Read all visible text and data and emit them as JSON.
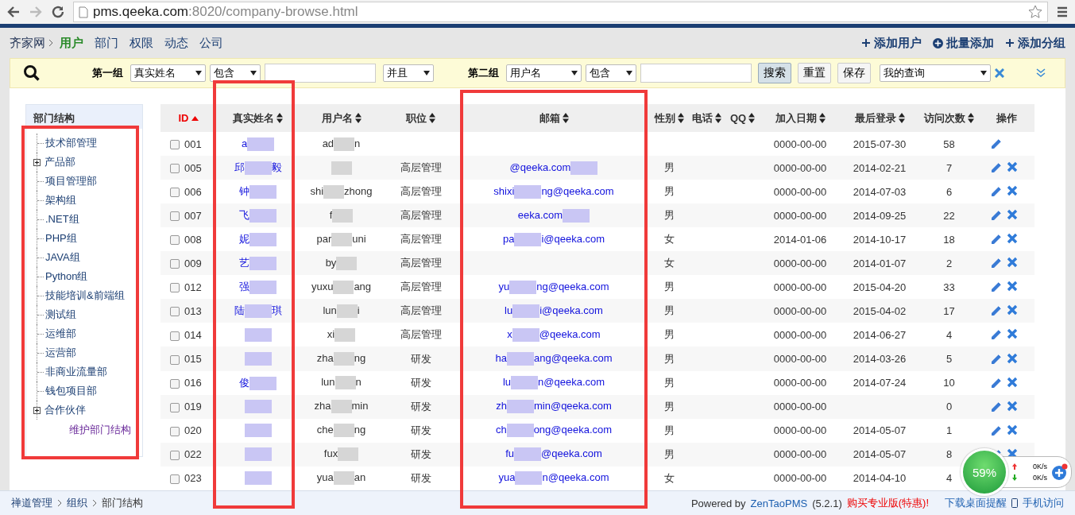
{
  "browser": {
    "url_host": "pms.qeeka.com",
    "url_rest": ":8020/company-browse.html"
  },
  "nav": {
    "root": "齐家网",
    "tabs": [
      {
        "label": "用户",
        "selected": true
      },
      {
        "label": "部门",
        "selected": false
      },
      {
        "label": "权限",
        "selected": false
      },
      {
        "label": "动态",
        "selected": false
      },
      {
        "label": "公司",
        "selected": false
      }
    ],
    "actions": [
      {
        "kind": "plus",
        "label": "添加用户"
      },
      {
        "kind": "plus-circle",
        "label": "批量添加"
      },
      {
        "kind": "plus",
        "label": "添加分组"
      }
    ]
  },
  "filter": {
    "group1": {
      "label": "第一组",
      "field": "真实姓名",
      "operator": "包含"
    },
    "join": "并且",
    "group2": {
      "label": "第二组",
      "field": "用户名",
      "operator": "包含"
    },
    "buttons": [
      {
        "label": "搜索",
        "selected": true
      },
      {
        "label": "重置",
        "selected": false
      },
      {
        "label": "保存",
        "selected": false
      }
    ],
    "saved_query": "我的查询"
  },
  "sidebar": {
    "title": "部门结构",
    "items": [
      {
        "label": "技术部管理",
        "expandable": false
      },
      {
        "label": "产品部",
        "expandable": true
      },
      {
        "label": "项目管理部",
        "expandable": false
      },
      {
        "label": "架构组",
        "expandable": false
      },
      {
        "label": ".NET组",
        "expandable": false
      },
      {
        "label": "PHP组",
        "expandable": false
      },
      {
        "label": "JAVA组",
        "expandable": false
      },
      {
        "label": "Python组",
        "expandable": false
      },
      {
        "label": "技能培训&前端组",
        "expandable": false
      },
      {
        "label": "测试组",
        "expandable": false
      },
      {
        "label": "运维部",
        "expandable": false
      },
      {
        "label": "运营部",
        "expandable": false
      },
      {
        "label": "非商业流量部",
        "expandable": false
      },
      {
        "label": "钱包项目部",
        "expandable": false
      },
      {
        "label": "合作伙伴",
        "expandable": true
      }
    ],
    "link": "维护部门结构",
    "highlighted": true
  },
  "table": {
    "columns": [
      {
        "label": "ID",
        "sortable": true,
        "sorted": true
      },
      {
        "label": "真实姓名",
        "sortable": true,
        "sorted": false,
        "highlighted": true
      },
      {
        "label": "用户名",
        "sortable": true,
        "sorted": false
      },
      {
        "label": "职位",
        "sortable": true,
        "sorted": false
      },
      {
        "label": "邮箱",
        "sortable": true,
        "sorted": false,
        "highlighted": true
      },
      {
        "label": "性别",
        "sortable": true,
        "sorted": false
      },
      {
        "label": "电话",
        "sortable": true,
        "sorted": false
      },
      {
        "label": "QQ",
        "sortable": true,
        "sorted": false
      },
      {
        "label": "加入日期",
        "sortable": true,
        "sorted": false
      },
      {
        "label": "最后登录",
        "sortable": true,
        "sorted": false
      },
      {
        "label": "访问次数",
        "sortable": true,
        "sorted": false
      },
      {
        "label": "操作",
        "sortable": false,
        "sorted": false
      }
    ],
    "rows": [
      {
        "checked": false,
        "id": "001",
        "name": [
          "a"
        ],
        "username": [
          "ad",
          "n"
        ],
        "post": "",
        "email": [],
        "gender": "",
        "join": "0000-00-00",
        "last": "2015-07-30",
        "visits": "58",
        "editable": true,
        "deletable": false
      },
      {
        "checked": false,
        "id": "005",
        "name": [
          "邱",
          "毅"
        ],
        "username": [],
        "post": "高层管理",
        "email": [
          "@qeeka.com"
        ],
        "gender": "男",
        "join": "0000-00-00",
        "last": "2014-02-21",
        "visits": "7",
        "editable": true,
        "deletable": true
      },
      {
        "checked": false,
        "id": "006",
        "name": [
          "钟"
        ],
        "username": [
          "shi",
          "zhong"
        ],
        "post": "高层管理",
        "email": [
          "shixi",
          "ng@qeeka.com"
        ],
        "gender": "男",
        "join": "0000-00-00",
        "last": "2014-07-03",
        "visits": "6",
        "editable": true,
        "deletable": true
      },
      {
        "checked": false,
        "id": "007",
        "name": [
          "飞"
        ],
        "username": [
          "f"
        ],
        "post": "高层管理",
        "email": [
          "eeka.com"
        ],
        "gender": "男",
        "join": "0000-00-00",
        "last": "2014-09-25",
        "visits": "22",
        "editable": true,
        "deletable": true
      },
      {
        "checked": false,
        "id": "008",
        "name": [
          "妮"
        ],
        "username": [
          "par",
          "uni"
        ],
        "post": "高层管理",
        "email": [
          "pa",
          "i@qeeka.com"
        ],
        "gender": "女",
        "join": "2014-01-06",
        "last": "2014-10-17",
        "visits": "18",
        "editable": true,
        "deletable": true
      },
      {
        "checked": false,
        "id": "009",
        "name": [
          "艺"
        ],
        "username": [
          "by"
        ],
        "post": "高层管理",
        "email": [],
        "gender": "女",
        "join": "0000-00-00",
        "last": "2014-01-07",
        "visits": "2",
        "editable": true,
        "deletable": true
      },
      {
        "checked": false,
        "id": "012",
        "name": [
          "强"
        ],
        "username": [
          "yuxu",
          "ang"
        ],
        "post": "高层管理",
        "email": [
          "yu",
          "ng@qeeka.com"
        ],
        "gender": "男",
        "join": "0000-00-00",
        "last": "2015-04-20",
        "visits": "33",
        "editable": true,
        "deletable": true
      },
      {
        "checked": false,
        "id": "013",
        "name": [
          "陆",
          "琪"
        ],
        "username": [
          "lun",
          "i"
        ],
        "post": "高层管理",
        "email": [
          "lu",
          "i@qeeka.com"
        ],
        "gender": "男",
        "join": "0000-00-00",
        "last": "2015-04-02",
        "visits": "17",
        "editable": true,
        "deletable": true
      },
      {
        "checked": false,
        "id": "014",
        "name": [],
        "username": [
          "xi"
        ],
        "post": "高层管理",
        "email": [
          "x",
          "@qeeka.com"
        ],
        "gender": "男",
        "join": "0000-00-00",
        "last": "2014-06-27",
        "visits": "4",
        "editable": true,
        "deletable": true
      },
      {
        "checked": false,
        "id": "015",
        "name": [],
        "username": [
          "zha",
          "ng"
        ],
        "post": "研发",
        "email": [
          "ha",
          "ang@qeeka.com"
        ],
        "gender": "男",
        "join": "0000-00-00",
        "last": "2014-03-26",
        "visits": "5",
        "editable": true,
        "deletable": true
      },
      {
        "checked": false,
        "id": "016",
        "name": [
          "俊"
        ],
        "username": [
          "lun",
          "n"
        ],
        "post": "研发",
        "email": [
          "lu",
          "n@qeeka.com"
        ],
        "gender": "男",
        "join": "0000-00-00",
        "last": "2014-07-24",
        "visits": "10",
        "editable": true,
        "deletable": true
      },
      {
        "checked": false,
        "id": "019",
        "name": [],
        "username": [
          "zha",
          "min"
        ],
        "post": "研发",
        "email": [
          "zh",
          "min@qeeka.com"
        ],
        "gender": "男",
        "join": "0000-00-00",
        "last": "",
        "visits": "0",
        "editable": true,
        "deletable": true
      },
      {
        "checked": false,
        "id": "020",
        "name": [],
        "username": [
          "che",
          "ng"
        ],
        "post": "研发",
        "email": [
          "ch",
          "ong@qeeka.com"
        ],
        "gender": "男",
        "join": "0000-00-00",
        "last": "2014-05-07",
        "visits": "1",
        "editable": true,
        "deletable": true
      },
      {
        "checked": false,
        "id": "022",
        "name": [],
        "username": [
          "fux"
        ],
        "post": "研发",
        "email": [
          "fu",
          "@qeeka.com"
        ],
        "gender": "男",
        "join": "0000-00-00",
        "last": "2014-05-07",
        "visits": "8",
        "editable": true,
        "deletable": true
      },
      {
        "checked": false,
        "id": "023",
        "name": [],
        "username": [
          "yua",
          "an"
        ],
        "post": "研发",
        "email": [
          "yua",
          "n@qeeka.com"
        ],
        "gender": "女",
        "join": "0000-00-00",
        "last": "2014-04-10",
        "visits": "4"
      }
    ]
  },
  "footer": {
    "breadcrumb": [
      "禅道管理",
      "组织",
      "部门结构"
    ],
    "powered": "Powered by",
    "product": "ZenTaoPMS",
    "version": "(5.2.1)",
    "buy": "购买专业版(特惠)!",
    "download": "下载桌面提醒",
    "mobile": "手机访问"
  },
  "speed_widget": {
    "percent": "59%",
    "upload": "0K/s",
    "download": "0K/s"
  }
}
